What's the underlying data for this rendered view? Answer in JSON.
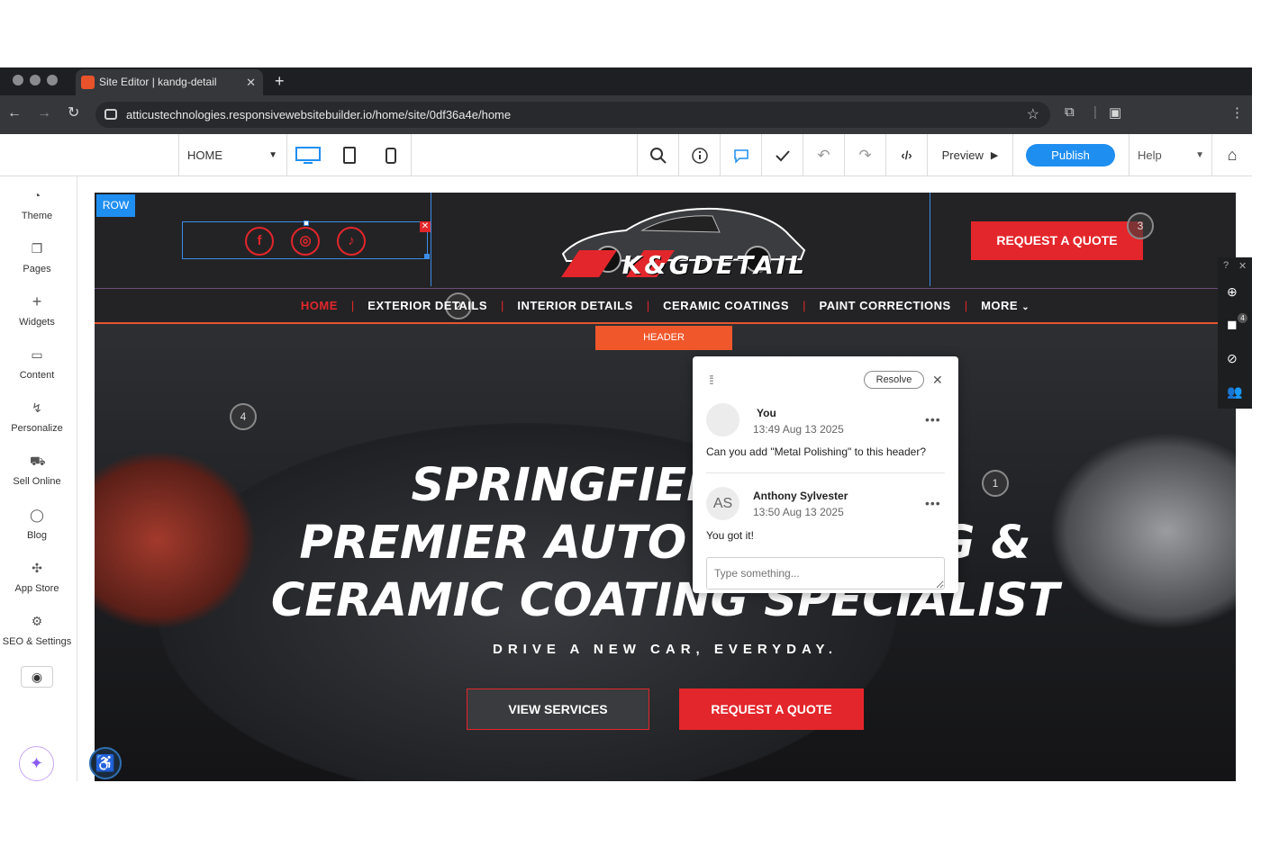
{
  "browser": {
    "tab_title": "Site Editor | kandg-detail",
    "url": "atticustechnologies.responsivewebsitebuilder.io/home/site/0df36a4e/home"
  },
  "toolbar": {
    "page_select": "HOME",
    "preview_label": "Preview",
    "publish_label": "Publish",
    "help_label": "Help"
  },
  "sidebar": {
    "items": [
      {
        "label": "Theme",
        "icon": "palette-icon"
      },
      {
        "label": "Pages",
        "icon": "pages-icon"
      },
      {
        "label": "Widgets",
        "icon": "plus-icon"
      },
      {
        "label": "Content",
        "icon": "folder-icon"
      },
      {
        "label": "Personalize",
        "icon": "personalize-icon"
      },
      {
        "label": "Sell Online",
        "icon": "cart-icon"
      },
      {
        "label": "Blog",
        "icon": "chat-bubble-icon"
      },
      {
        "label": "App Store",
        "icon": "puzzle-icon"
      },
      {
        "label": "SEO & Settings",
        "icon": "gear-icon"
      }
    ]
  },
  "canvas": {
    "row_tag": "ROW",
    "logo_text": "K&GDETAIL",
    "request_quote_top": "REQUEST A QUOTE",
    "markers": [
      "1",
      "2",
      "3",
      "4"
    ],
    "nav": [
      "HOME",
      "EXTERIOR DETAILS",
      "INTERIOR DETAILS",
      "CERAMIC COATINGS",
      "PAINT CORRECTIONS",
      "MORE"
    ],
    "header_tag": "HEADER",
    "hero_line1": "SPRINGFIELD, MO'S",
    "hero_line2": "PREMIER AUTO DETAILING &",
    "hero_line3": "CERAMIC COATING SPECIALIST",
    "tagline": "DRIVE A NEW CAR, EVERYDAY.",
    "view_services": "VIEW SERVICES",
    "request_quote_hero": "REQUEST A QUOTE"
  },
  "right_toolbar": {
    "help": "?",
    "badge_count": "4"
  },
  "comment": {
    "resolve_label": "Resolve",
    "entries": [
      {
        "avatar": "",
        "name": "You",
        "time": "13:49 Aug 13 2025",
        "message": "Can you add \"Metal Polishing\" to this header?"
      },
      {
        "avatar": "AS",
        "name": "Anthony Sylvester",
        "time": "13:50 Aug 13 2025",
        "message": "You got it!"
      }
    ],
    "input_placeholder": "Type something..."
  },
  "colors": {
    "accent": "#1f8ef1",
    "brand_red": "#e3262b",
    "header_orange": "#f0582c"
  }
}
